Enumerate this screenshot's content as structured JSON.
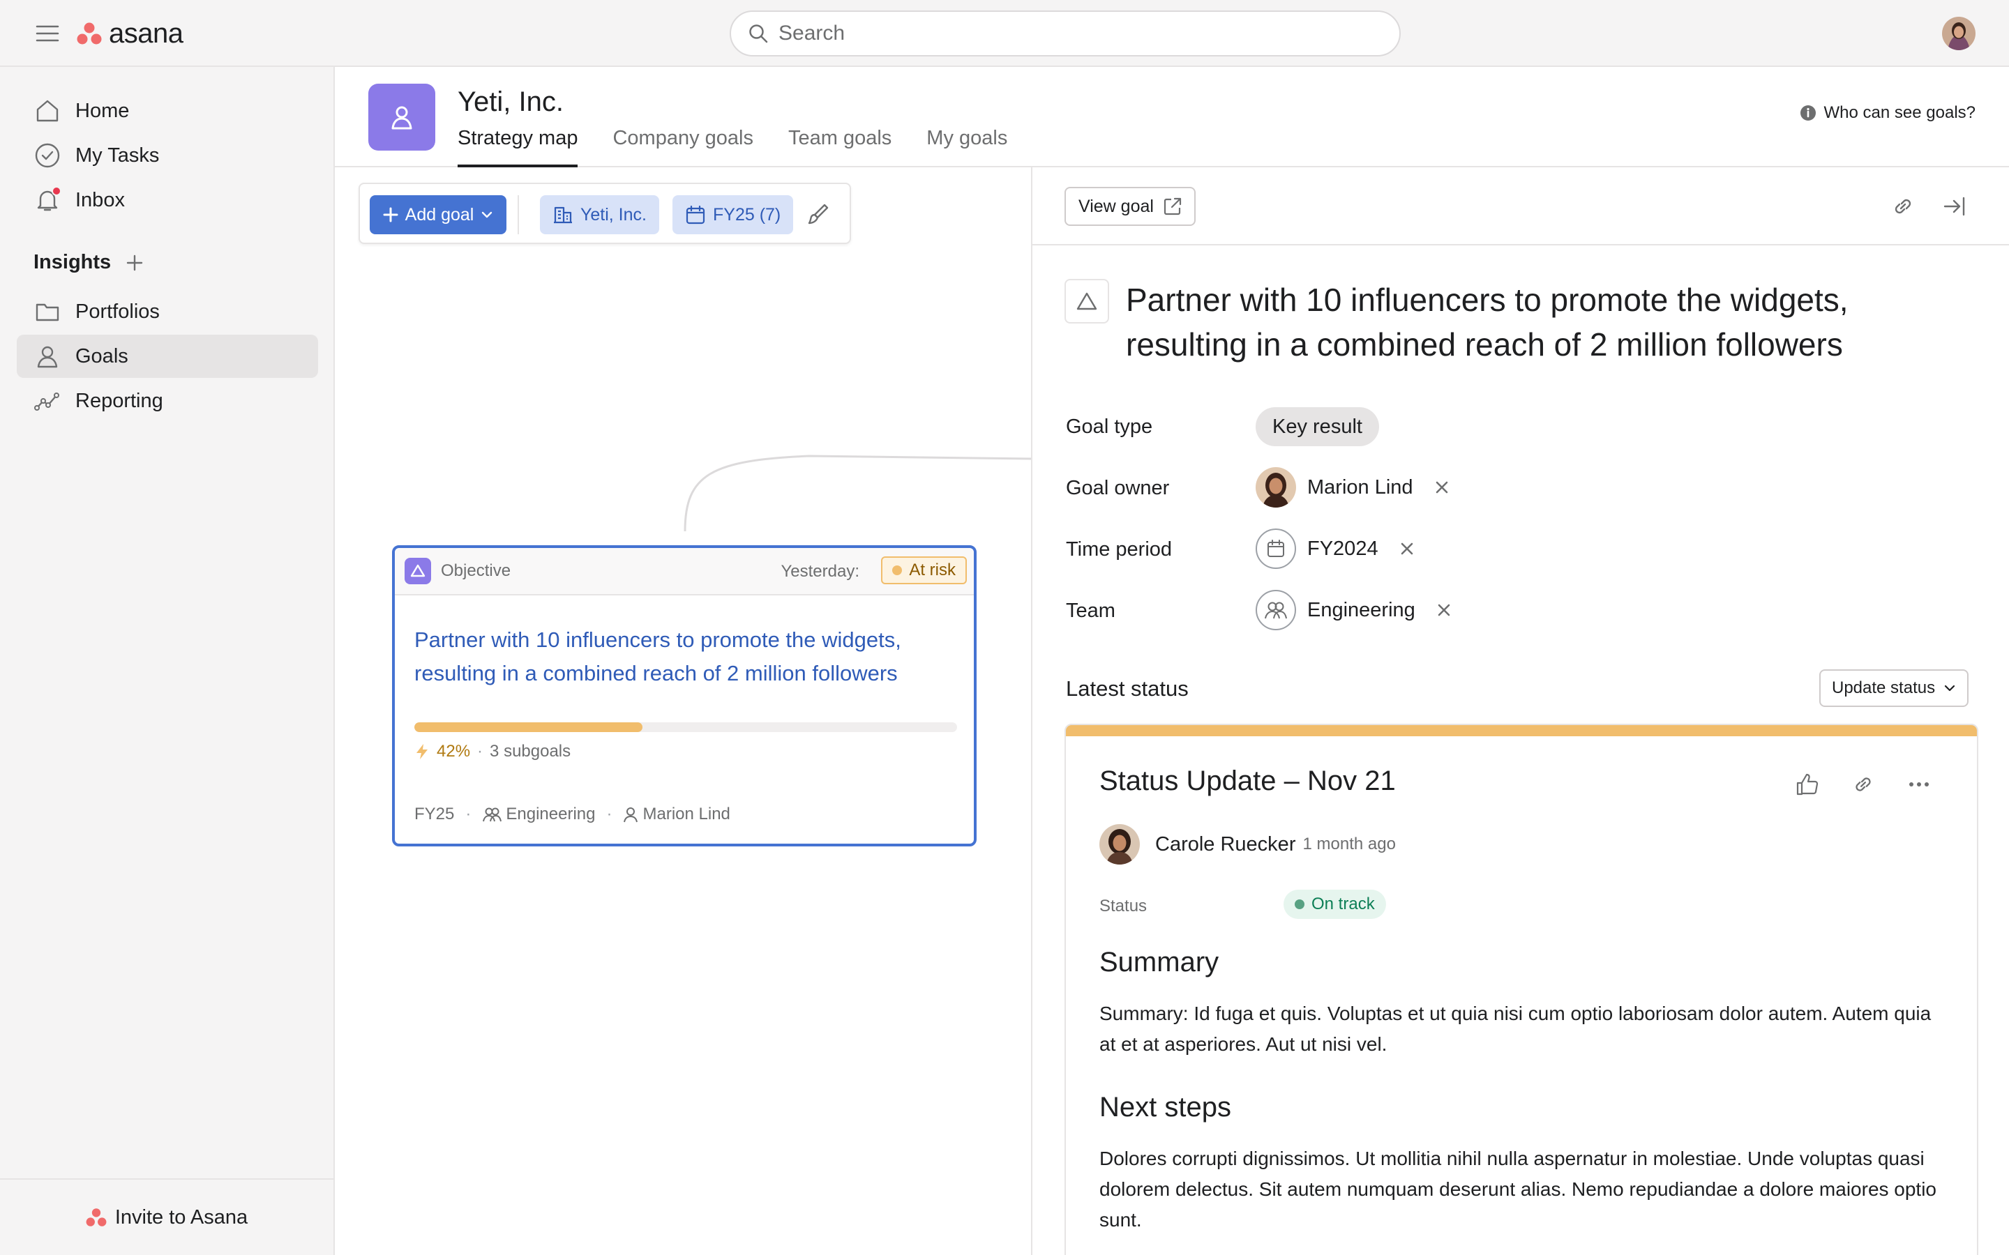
{
  "topbar": {
    "logo": "asana",
    "search_placeholder": "Search"
  },
  "sidebar": {
    "items": [
      {
        "label": "Home",
        "icon": "home-icon"
      },
      {
        "label": "My Tasks",
        "icon": "check-circle-icon"
      },
      {
        "label": "Inbox",
        "icon": "bell-icon"
      }
    ],
    "insights_label": "Insights",
    "insights_items": [
      {
        "label": "Portfolios",
        "icon": "folder-icon"
      },
      {
        "label": "Goals",
        "icon": "goal-person-icon",
        "active": true
      },
      {
        "label": "Reporting",
        "icon": "reporting-icon"
      }
    ],
    "invite_label": "Invite to Asana"
  },
  "header": {
    "org_name": "Yeti, Inc.",
    "tabs": [
      "Strategy map",
      "Company goals",
      "Team goals",
      "My goals"
    ],
    "active_tab": "Strategy map",
    "who_can_see": "Who can see goals?"
  },
  "toolbar": {
    "add_goal": "Add goal",
    "org_filter": "Yeti, Inc.",
    "period_filter": "FY25 (7)"
  },
  "goal_card": {
    "type": "Objective",
    "yesterday_label": "Yesterday:",
    "status": "At risk",
    "title": "Partner with 10 influencers to promote the widgets, resulting in a combined reach of 2 million followers",
    "progress": 0.42,
    "progress_label": "42%",
    "subgoals": "3 subgoals",
    "period": "FY25",
    "team": "Engineering",
    "owner": "Marion Lind"
  },
  "detail": {
    "view_goal": "View goal",
    "title": "Partner with 10 influencers to promote the widgets, resulting in a combined reach of 2 million followers",
    "fields": {
      "goal_type_label": "Goal type",
      "goal_type": "Key result",
      "goal_owner_label": "Goal owner",
      "goal_owner": "Marion Lind",
      "time_period_label": "Time period",
      "time_period": "FY2024",
      "team_label": "Team",
      "team": "Engineering"
    },
    "latest_status_label": "Latest status",
    "update_status": "Update status",
    "status_update": {
      "title": "Status Update – Nov 21",
      "author": "Carole Ruecker",
      "time": "1 month ago",
      "status_label": "Status",
      "status": "On track",
      "summary_heading": "Summary",
      "summary": "Summary: Id fuga et quis. Voluptas et ut quia nisi cum optio laboriosam dolor autem. Autem quia at et at asperiores. Aut ut nisi vel.",
      "next_heading": "Next steps",
      "next": "Dolores corrupti dignissimos. Ut mollitia nihil nulla aspernatur in molestiae. Unde voluptas quasi dolorem delectus. Sit autem numquam deserunt alias. Nemo repudiandae a dolore maiores optio sunt."
    }
  },
  "colors": {
    "accent_blue": "#4573d2",
    "brand_coral": "#f06a6a",
    "at_risk": "#f1bd6c",
    "on_track": "#58a182",
    "team_purple": "#8b7ae8"
  }
}
